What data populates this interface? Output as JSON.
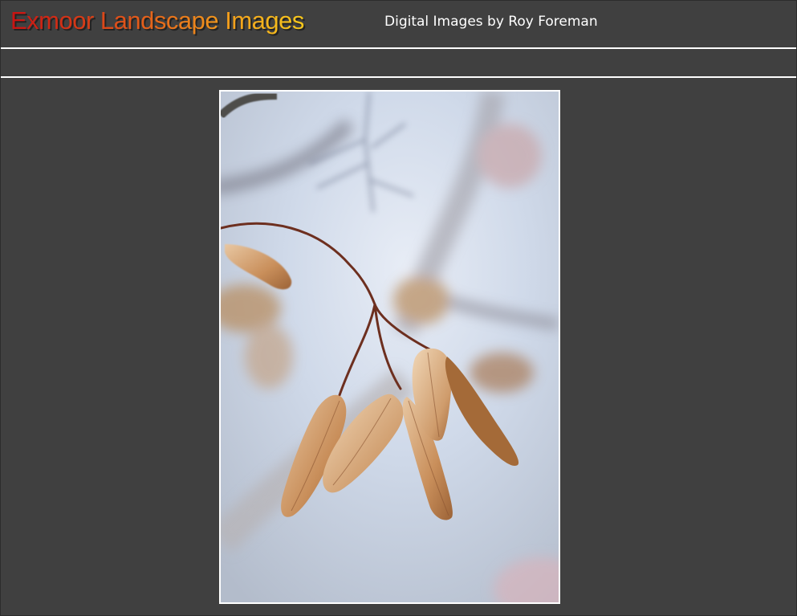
{
  "header": {
    "logo_text": "Exmoor Landscape Images",
    "tagline": "Digital Images by Roy Foreman"
  },
  "photo": {
    "subject": "sycamore seeds photograph"
  },
  "colors": {
    "page_background": "#404040",
    "rule": "#ffffff",
    "logo_gradient_start": "#c81212",
    "logo_gradient_end": "#f7c81c",
    "tagline": "#ffffff"
  }
}
